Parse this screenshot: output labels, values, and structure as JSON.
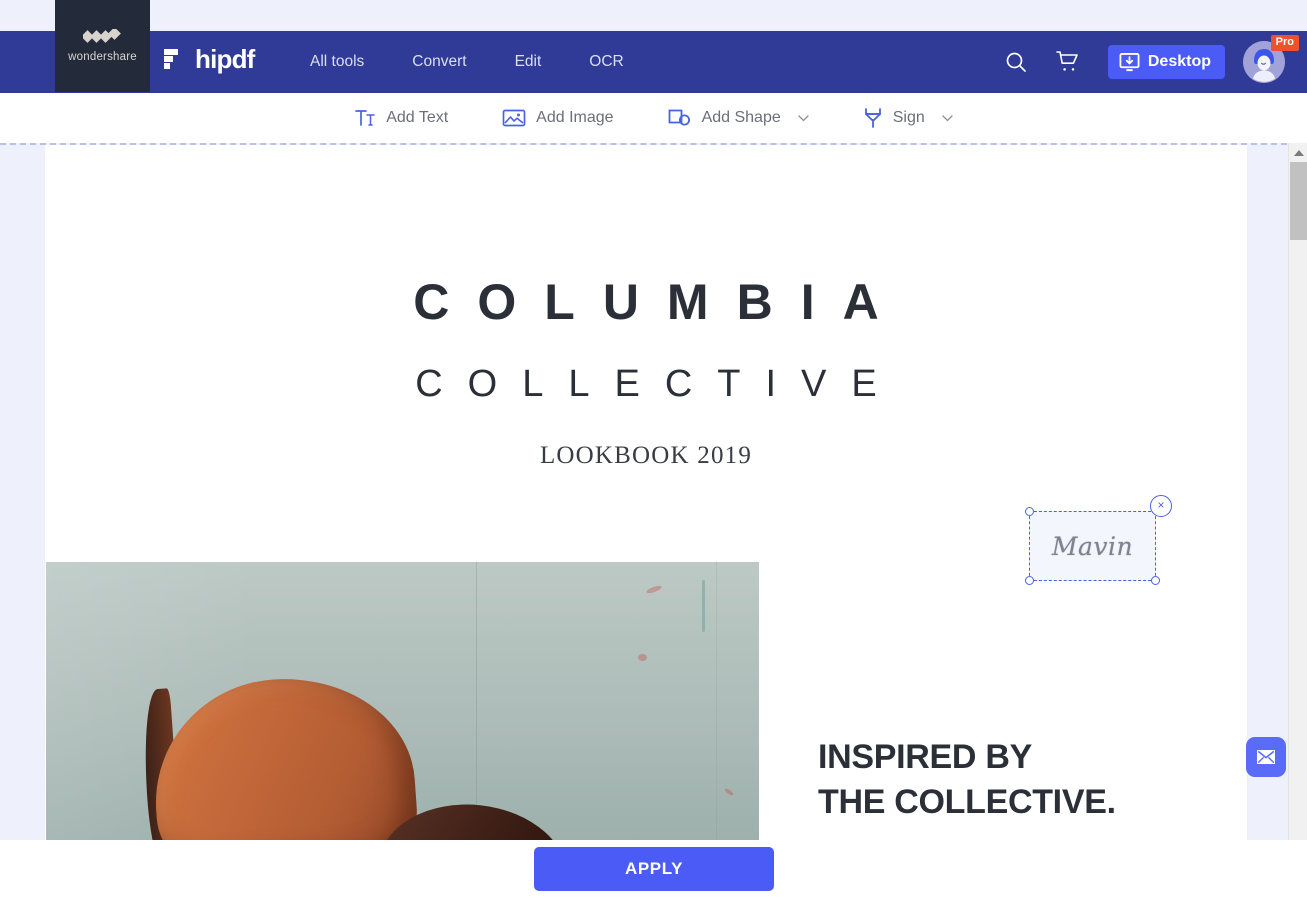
{
  "header": {
    "brand_logo_label": "wondershare",
    "product_name": "hipdf",
    "nav": [
      {
        "label": "All tools"
      },
      {
        "label": "Convert"
      },
      {
        "label": "Edit"
      },
      {
        "label": "OCR"
      }
    ],
    "search_icon": "search-icon",
    "cart_icon": "cart-icon",
    "desktop_button": "Desktop",
    "desktop_icon": "download-to-desktop-icon",
    "avatar_icon": "user-avatar",
    "pro_badge": "Pro",
    "bg_color": "#2f3b96",
    "logo_bg_color": "#232b3b",
    "desktop_btn_color": "#4a5cf5",
    "pro_badge_color": "#f0502d"
  },
  "toolbar": {
    "items": [
      {
        "label": "Add Text",
        "icon": "text-insert-icon",
        "has_caret": false
      },
      {
        "label": "Add Image",
        "icon": "image-icon",
        "has_caret": false
      },
      {
        "label": "Add Shape",
        "icon": "shape-icon",
        "has_caret": true
      },
      {
        "label": "Sign",
        "icon": "sign-pen-icon",
        "has_caret": true
      }
    ],
    "accent_color": "#4a62e0"
  },
  "document": {
    "title": "COLUMBIA",
    "subtitle": "COLLECTIVE",
    "lookbook": "LOOKBOOK 2019",
    "headline_line1": "INSPIRED BY",
    "headline_line2": "THE COLLECTIVE.",
    "photo_alt": "orange leather chair against pale teal wall"
  },
  "signature": {
    "text": "Mavin",
    "close_label": "×",
    "selection_color": "#4a62e0",
    "state": "selected"
  },
  "floating": {
    "mail_icon": "mail-envelope-icon",
    "mail_color": "#5a6bf8"
  },
  "footer": {
    "apply_label": "APPLY",
    "apply_color": "#4a5cf5"
  },
  "scrollbar": {
    "up_arrow_icon": "scroll-up-arrow-icon"
  }
}
